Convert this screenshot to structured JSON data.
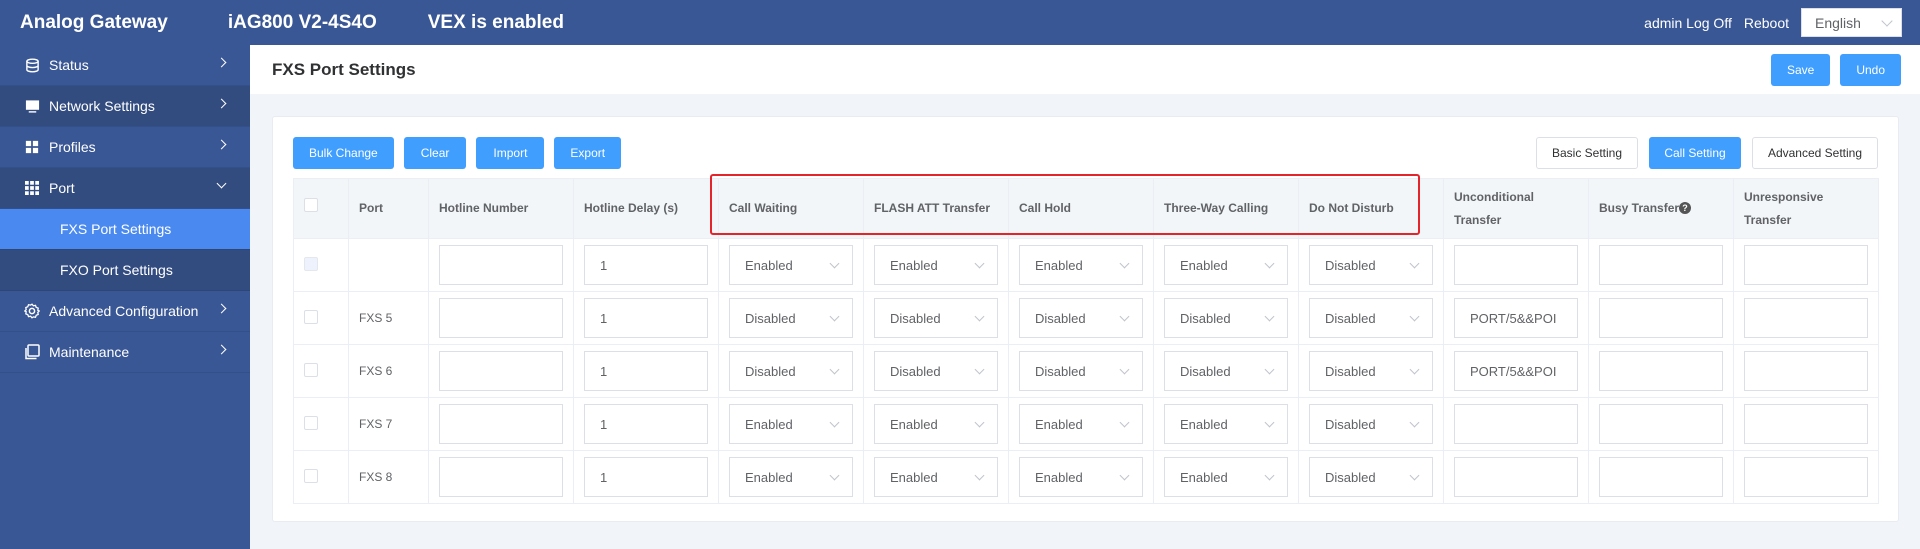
{
  "topbar": {
    "brand": "Analog Gateway",
    "model": "iAG800 V2-4S4O",
    "vex_status": "VEX is enabled",
    "user_logoff": "admin Log Off",
    "reboot": "Reboot",
    "language": "English"
  },
  "sidebar": {
    "items": [
      {
        "label": "Status",
        "icon": "database-icon"
      },
      {
        "label": "Network Settings",
        "icon": "monitor-icon"
      },
      {
        "label": "Profiles",
        "icon": "grid-icon"
      },
      {
        "label": "Port",
        "icon": "table-grid-icon",
        "expanded": true,
        "children": [
          {
            "label": "FXS Port Settings",
            "active": true
          },
          {
            "label": "FXO Port Settings"
          }
        ]
      },
      {
        "label": "Advanced Configuration",
        "icon": "gear-icon"
      },
      {
        "label": "Maintenance",
        "icon": "copy-icon"
      }
    ]
  },
  "header": {
    "title": "FXS Port Settings",
    "save": "Save",
    "undo": "Undo"
  },
  "toolbar": {
    "bulk_change": "Bulk Change",
    "clear": "Clear",
    "import": "Import",
    "export": "Export"
  },
  "tabs": {
    "basic": "Basic Setting",
    "call": "Call Setting",
    "advanced": "Advanced Setting",
    "active": "Call Setting"
  },
  "table": {
    "headers": {
      "port": "Port",
      "hotline_number": "Hotline Number",
      "hotline_delay": "Hotline Delay (s)",
      "call_waiting": "Call Waiting",
      "flash_att": "FLASH ATT Transfer",
      "call_hold": "Call Hold",
      "three_way": "Three-Way Calling",
      "dnd": "Do Not Disturb",
      "unconditional_1": "Unconditional",
      "unconditional_2": "Transfer",
      "busy": "Busy Transfer",
      "unresponsive_1": "Unresponsive",
      "unresponsive_2": "Transfer"
    },
    "rows": [
      {
        "port": "",
        "hotline": "",
        "delay": "1",
        "call_waiting": "Enabled",
        "flash_att": "Enabled",
        "call_hold": "Enabled",
        "three_way": "Enabled",
        "dnd": "Disabled",
        "unconditional": "",
        "busy": "",
        "unresponsive": ""
      },
      {
        "port": "FXS 5",
        "hotline": "",
        "delay": "1",
        "call_waiting": "Disabled",
        "flash_att": "Disabled",
        "call_hold": "Disabled",
        "three_way": "Disabled",
        "dnd": "Disabled",
        "unconditional": "PORT/5&&POI",
        "busy": "",
        "unresponsive": ""
      },
      {
        "port": "FXS 6",
        "hotline": "",
        "delay": "1",
        "call_waiting": "Disabled",
        "flash_att": "Disabled",
        "call_hold": "Disabled",
        "three_way": "Disabled",
        "dnd": "Disabled",
        "unconditional": "PORT/5&&POI",
        "busy": "",
        "unresponsive": ""
      },
      {
        "port": "FXS 7",
        "hotline": "",
        "delay": "1",
        "call_waiting": "Enabled",
        "flash_att": "Enabled",
        "call_hold": "Enabled",
        "three_way": "Enabled",
        "dnd": "Disabled",
        "unconditional": "",
        "busy": "",
        "unresponsive": ""
      },
      {
        "port": "FXS 8",
        "hotline": "",
        "delay": "1",
        "call_waiting": "Enabled",
        "flash_att": "Enabled",
        "call_hold": "Enabled",
        "three_way": "Enabled",
        "dnd": "Disabled",
        "unconditional": "",
        "busy": "",
        "unresponsive": ""
      }
    ]
  },
  "colors": {
    "nav_bg": "#3a5795",
    "accent": "#409eff",
    "active_nav": "#4a8af0",
    "highlight": "#e3242b"
  }
}
